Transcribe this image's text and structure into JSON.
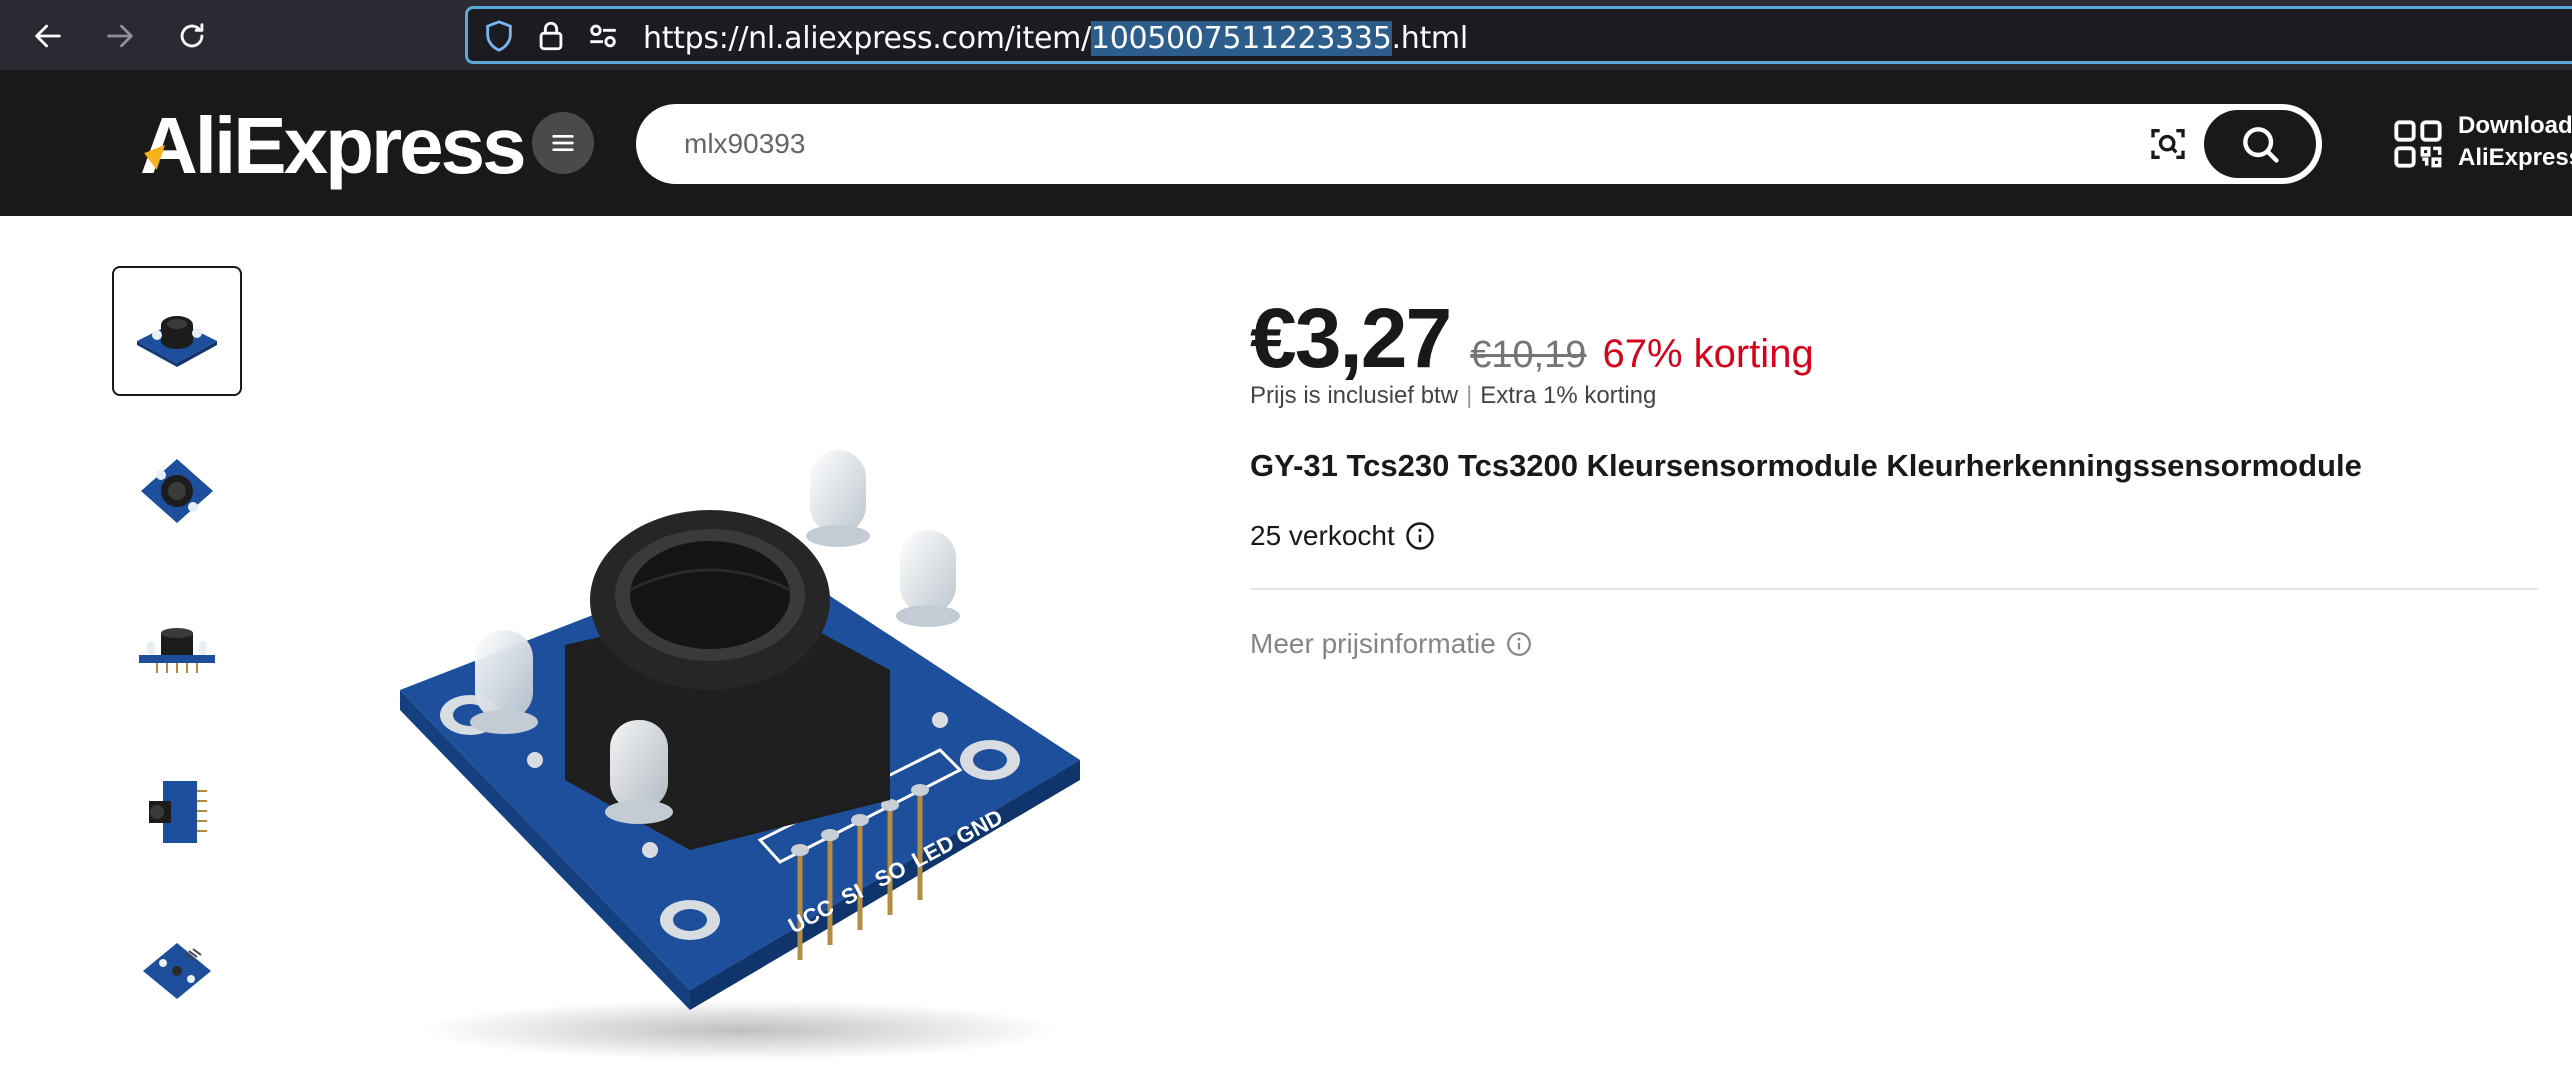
{
  "browser": {
    "url_prefix": "https://nl.aliexpress.com/item/",
    "url_selected": "1005007511223335",
    "url_suffix": ".html"
  },
  "header": {
    "logo_text": "AliExpress",
    "search_value": "mlx90393",
    "download_line1": "Download",
    "download_line2": "AliExpress"
  },
  "thumbnails": [
    {
      "name": "thumb-1",
      "active": true
    },
    {
      "name": "thumb-2",
      "active": false
    },
    {
      "name": "thumb-3",
      "active": false
    },
    {
      "name": "thumb-4",
      "active": false
    },
    {
      "name": "thumb-5",
      "active": false
    }
  ],
  "product": {
    "price": "€3,27",
    "original_price": "€10,19",
    "discount": "67% korting",
    "tax_note": "Prijs is inclusief btw",
    "extra_discount": "Extra 1% korting",
    "title": "GY-31 Tcs230 Tcs3200 Kleursensormodule Kleurherkenningssensormodule",
    "sold": "25 verkocht",
    "more_price_info": "Meer prijsinformatie",
    "pin_labels": [
      "UCC",
      "SI",
      "SO",
      "LED",
      "GND"
    ]
  },
  "colors": {
    "browser_bg": "#2b2a33",
    "header_bg": "#191919",
    "discount": "#d3031c",
    "pcb_blue": "#1e4f9c"
  }
}
